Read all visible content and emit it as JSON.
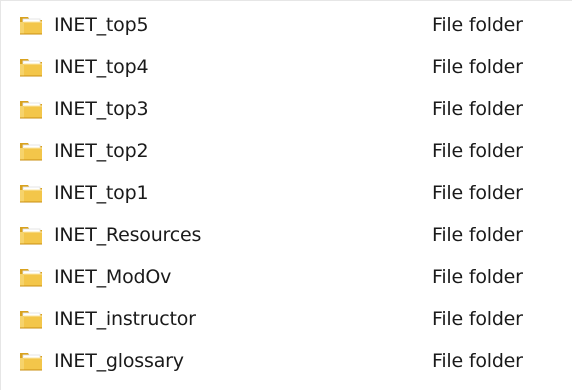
{
  "file_list": {
    "rows": [
      {
        "name": "INET_top5",
        "type": "File folder",
        "icon": "folder-icon"
      },
      {
        "name": "INET_top4",
        "type": "File folder",
        "icon": "folder-icon"
      },
      {
        "name": "INET_top3",
        "type": "File folder",
        "icon": "folder-icon"
      },
      {
        "name": "INET_top2",
        "type": "File folder",
        "icon": "folder-icon"
      },
      {
        "name": "INET_top1",
        "type": "File folder",
        "icon": "folder-icon"
      },
      {
        "name": "INET_Resources",
        "type": "File folder",
        "icon": "folder-icon"
      },
      {
        "name": "INET_ModOv",
        "type": "File folder",
        "icon": "folder-icon"
      },
      {
        "name": "INET_instructor",
        "type": "File folder",
        "icon": "folder-icon"
      },
      {
        "name": "INET_glossary",
        "type": "File folder",
        "icon": "folder-icon"
      }
    ]
  },
  "colors": {
    "folder_front": "#f3c64a",
    "folder_back": "#d9a21e",
    "folder_paper": "#ffffff",
    "text": "#1a1a1a"
  }
}
